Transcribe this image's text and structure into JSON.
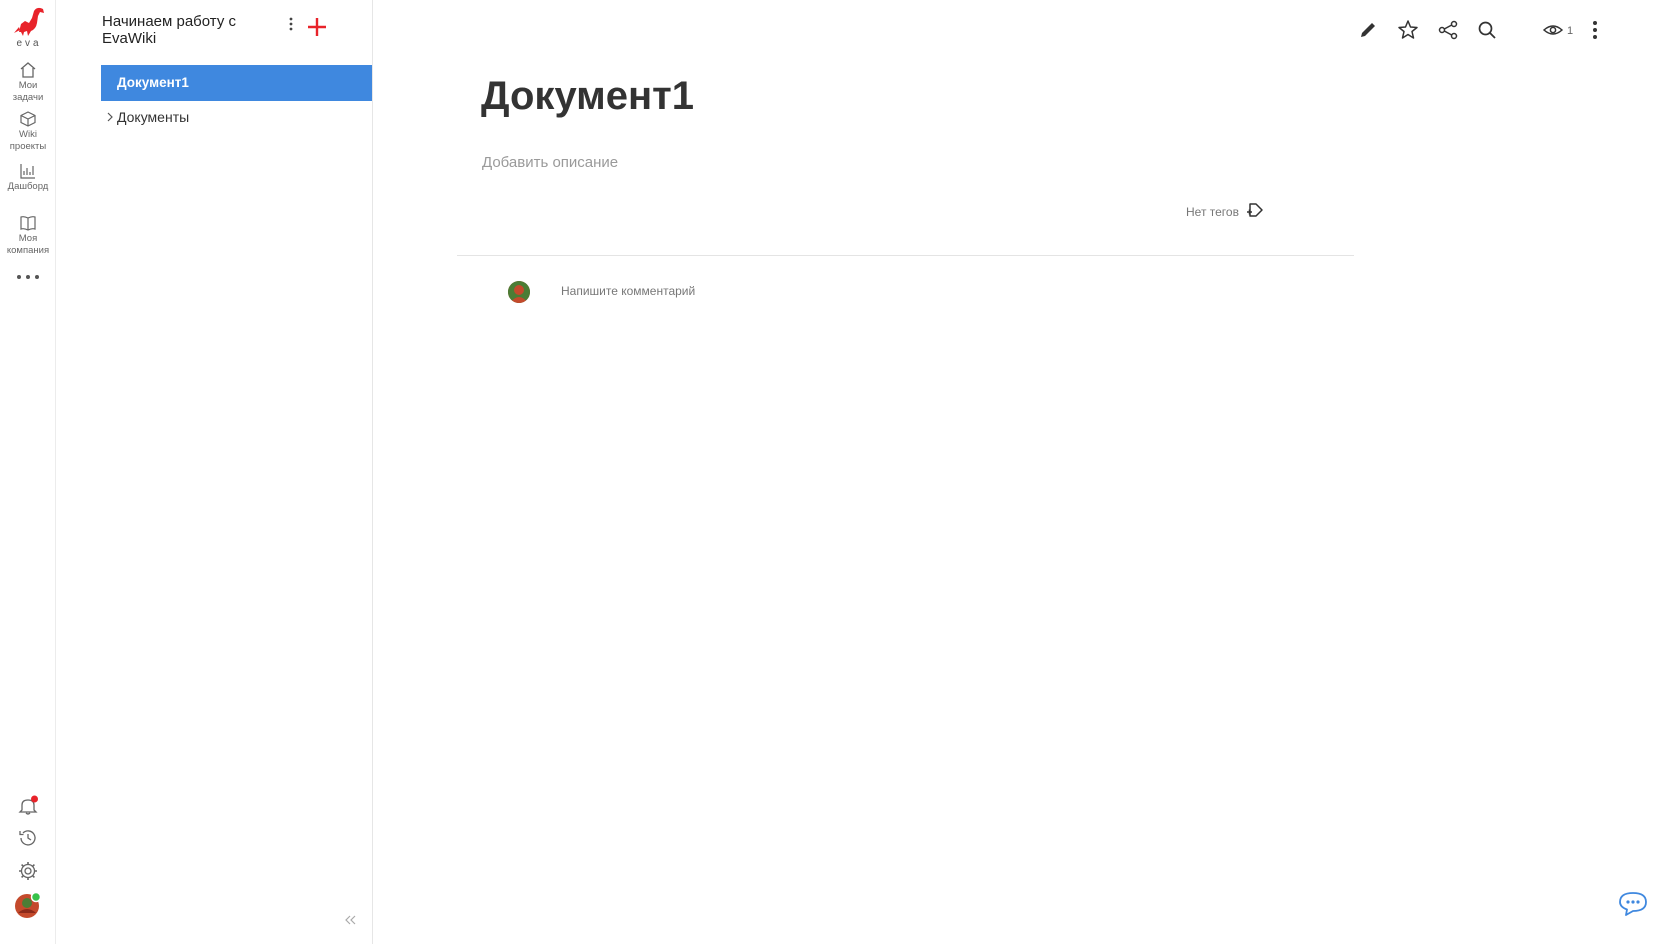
{
  "brand": {
    "logo_text": "eva",
    "accent": "#e8232a"
  },
  "rail": {
    "items": [
      {
        "label_line1": "Мои",
        "label_line2": "задачи",
        "icon": "home-icon"
      },
      {
        "label_line1": "Wiki",
        "label_line2": "проекты",
        "icon": "cube-icon"
      },
      {
        "label_line1": "Дашборд",
        "label_line2": "",
        "icon": "chart-icon"
      },
      {
        "label_line1": "Моя",
        "label_line2": "компания",
        "icon": "book-icon"
      }
    ],
    "more_icon": "more-dots-icon",
    "bottom_icons": [
      "bell-icon",
      "history-icon",
      "gear-icon",
      "avatar"
    ]
  },
  "tree": {
    "space_title": "Начинаем работу с EvaWiki",
    "active_item": "Документ1",
    "items": [
      {
        "label": "Документы",
        "icon": "chevron-right-icon"
      }
    ],
    "active_color": "#3f88df"
  },
  "toolbar": {
    "icons": [
      "pencil-icon",
      "star-icon",
      "share-icon",
      "search-icon",
      "eye-icon",
      "kebab-icon"
    ],
    "views_count": "1"
  },
  "document": {
    "title": "Документ1",
    "description_placeholder": "Добавить описание",
    "tags_text": "Нет тегов",
    "comment_placeholder": "Напишите комментарий"
  }
}
